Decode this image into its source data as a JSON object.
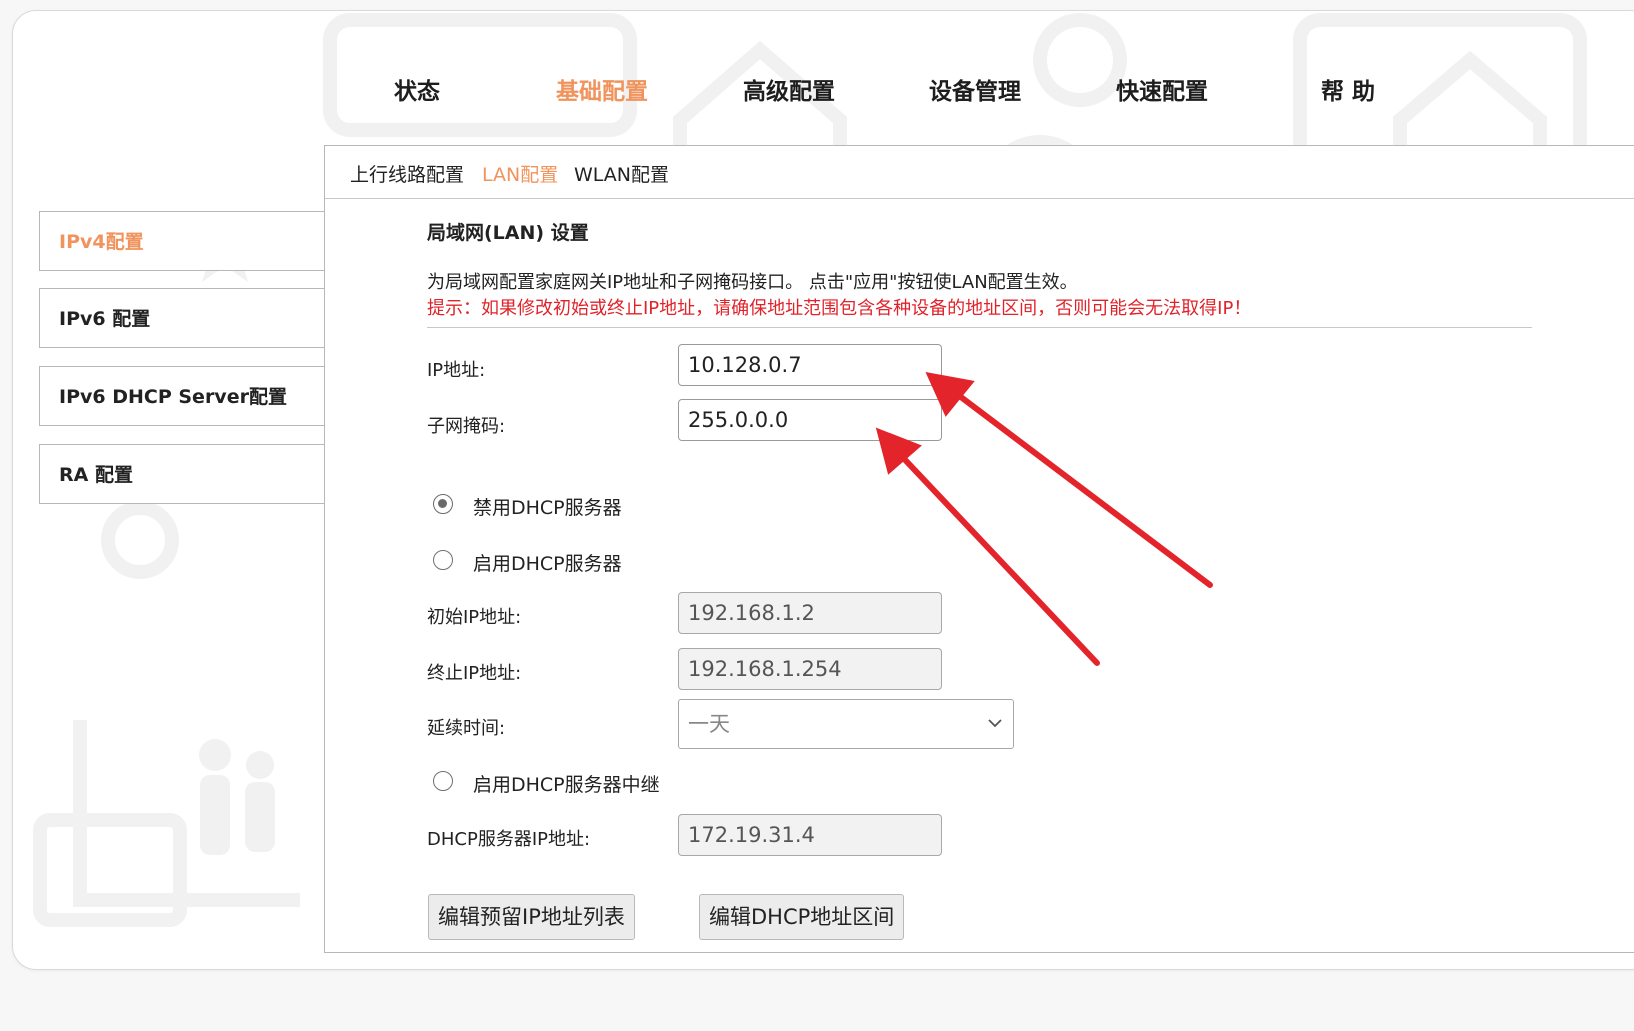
{
  "top_nav": [
    {
      "label": "状态"
    },
    {
      "label": "基础配置"
    },
    {
      "label": "高级配置"
    },
    {
      "label": "设备管理"
    },
    {
      "label": "快速配置"
    },
    {
      "label": "帮 助"
    }
  ],
  "sub_tabs": [
    {
      "label": "上行线路配置"
    },
    {
      "label": "LAN配置"
    },
    {
      "label": "WLAN配置"
    }
  ],
  "sidebar": [
    {
      "label": "IPv4配置"
    },
    {
      "label": "IPv6 配置"
    },
    {
      "label": "IPv6 DHCP Server配置"
    },
    {
      "label": "RA 配置"
    }
  ],
  "lan": {
    "title": "局域网(LAN) 设置",
    "description": "为局域网配置家庭网关IP地址和子网掩码接口。 点击\"应用\"按钮使LAN配置生效。",
    "hint": "提示：如果修改初始或终止IP地址，请确保地址范围包含各种设备的地址区间，否则可能会无法取得IP！",
    "ip_label": "IP地址:",
    "ip_value": "10.128.0.7",
    "mask_label": "子网掩码:",
    "mask_value": "255.0.0.0",
    "dhcp_disable_label": "禁用DHCP服务器",
    "dhcp_enable_label": "启用DHCP服务器",
    "start_ip_label": "初始IP地址:",
    "start_ip_value": "192.168.1.2",
    "end_ip_label": "终止IP地址:",
    "end_ip_value": "192.168.1.254",
    "lease_label": "延续时间:",
    "lease_value": "一天",
    "relay_label": "启用DHCP服务器中继",
    "relay_ip_label": "DHCP服务器IP地址:",
    "relay_ip_value": "172.19.31.4",
    "edit_reserved_button": "编辑预留IP地址列表",
    "edit_range_button": "编辑DHCP地址区间"
  },
  "state": {
    "active_top_nav": "基础配置",
    "active_sub_tab": "LAN配置",
    "active_sidebar": "IPv4配置",
    "dhcp_mode": "禁用DHCP服务器"
  },
  "colors": {
    "accent": "#f0935c",
    "hint_red": "#e0232a",
    "annotation_arrow": "#e3242b"
  }
}
